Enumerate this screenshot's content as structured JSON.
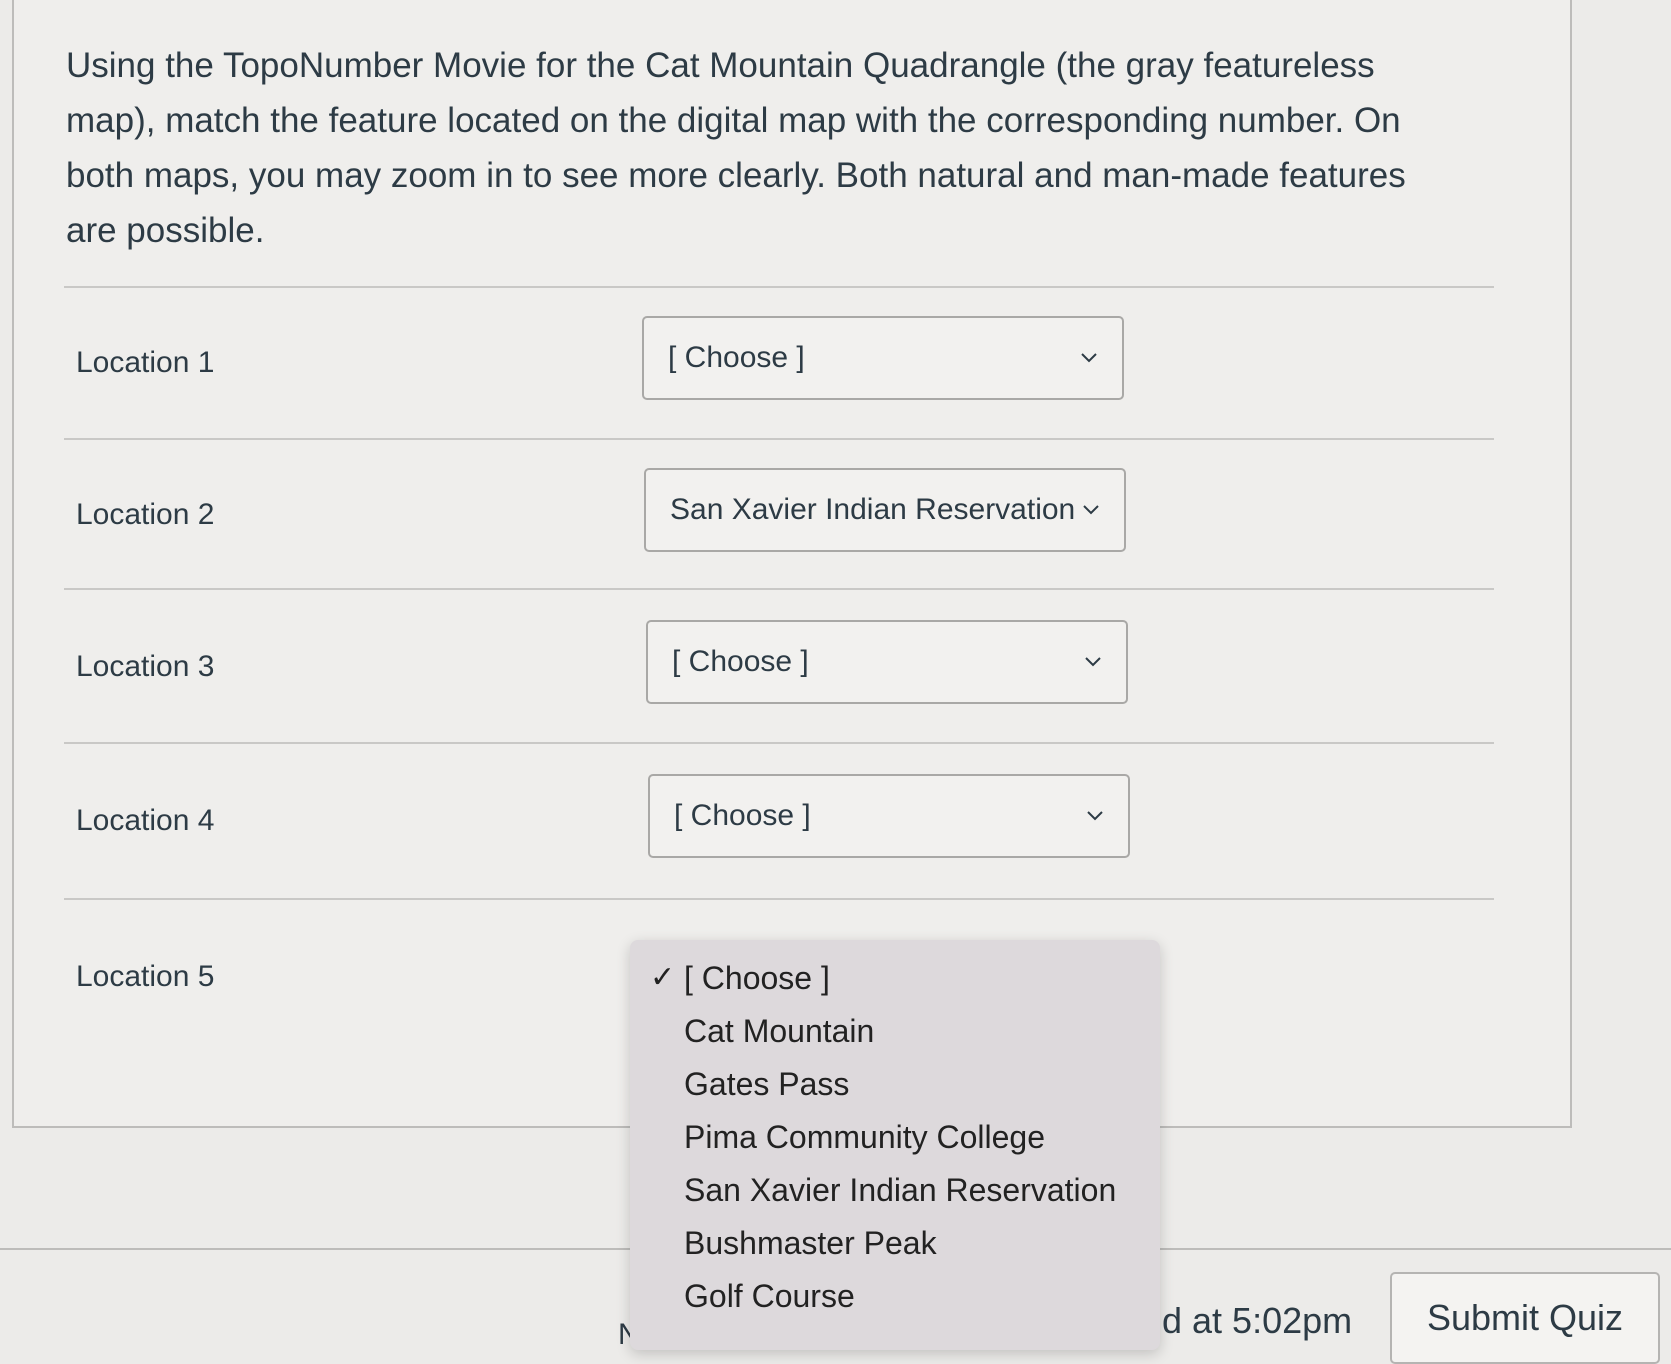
{
  "question": {
    "text": "Using the TopoNumber Movie for the Cat Mountain Quadrangle (the gray featureless map), match the feature located on the digital map with the corresponding number. On both maps, you may zoom in to see more clearly. Both natural and man-made features are possible."
  },
  "locations": [
    {
      "label": "Location 1",
      "selected": "[ Choose ]"
    },
    {
      "label": "Location 2",
      "selected": "San Xavier Indian Reservation"
    },
    {
      "label": "Location 3",
      "selected": "[ Choose ]"
    },
    {
      "label": "Location 4",
      "selected": "[ Choose ]"
    },
    {
      "label": "Location 5",
      "selected": "[ Choose ]"
    }
  ],
  "dropdown": {
    "checkmark": "✓",
    "options": [
      "[ Choose ]",
      "Cat Mountain",
      "Gates Pass",
      "Pima Community College",
      "San Xavier Indian Reservation",
      "Bushmaster Peak",
      "Golf Course"
    ]
  },
  "footer": {
    "saved_text": "d at 5:02pm",
    "submit_label": "Submit Quiz",
    "edge_glyph": "N"
  },
  "icons": {
    "select_chevron": "chevron-down-icon",
    "selected_option": "checkmark-icon"
  },
  "colors": {
    "page_background": "#ecebe9",
    "text": "#2d3b45",
    "menu_background": "#ddd9dc",
    "border": "#a9a8a6"
  }
}
